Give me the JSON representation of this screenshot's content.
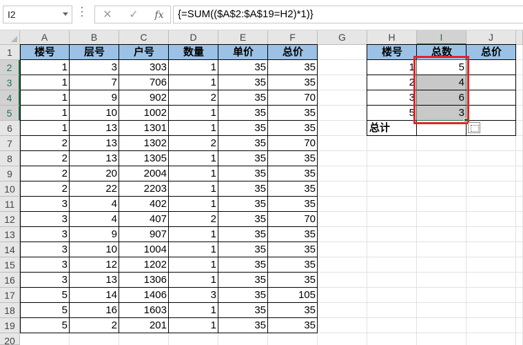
{
  "formula_bar": {
    "name_box": "I2",
    "cancel_glyph": "✕",
    "enter_glyph": "✓",
    "fx_label": "fx",
    "formula": "{=SUM(($A$2:$A$19=H2)*1)}"
  },
  "columns": [
    "A",
    "B",
    "C",
    "D",
    "E",
    "F",
    "G",
    "H",
    "I",
    "J"
  ],
  "rows": [
    "1",
    "2",
    "3",
    "4",
    "5",
    "6",
    "7",
    "8",
    "9",
    "10",
    "11",
    "12",
    "13",
    "14",
    "15",
    "16",
    "17",
    "18",
    "19",
    "20"
  ],
  "main_table": {
    "headers": [
      "楼号",
      "层号",
      "户号",
      "数量",
      "单价",
      "总价"
    ],
    "rows": [
      [
        "1",
        "3",
        "303",
        "1",
        "35",
        "35"
      ],
      [
        "1",
        "7",
        "706",
        "1",
        "35",
        "35"
      ],
      [
        "1",
        "9",
        "902",
        "2",
        "35",
        "70"
      ],
      [
        "1",
        "10",
        "1002",
        "1",
        "35",
        "35"
      ],
      [
        "1",
        "13",
        "1301",
        "1",
        "35",
        "35"
      ],
      [
        "2",
        "13",
        "1302",
        "2",
        "35",
        "70"
      ],
      [
        "2",
        "13",
        "1305",
        "1",
        "35",
        "35"
      ],
      [
        "2",
        "20",
        "2004",
        "1",
        "35",
        "35"
      ],
      [
        "2",
        "22",
        "2203",
        "1",
        "35",
        "35"
      ],
      [
        "3",
        "4",
        "402",
        "1",
        "35",
        "35"
      ],
      [
        "3",
        "4",
        "407",
        "2",
        "35",
        "70"
      ],
      [
        "3",
        "9",
        "907",
        "1",
        "35",
        "35"
      ],
      [
        "3",
        "10",
        "1004",
        "1",
        "35",
        "35"
      ],
      [
        "3",
        "12",
        "1202",
        "1",
        "35",
        "35"
      ],
      [
        "3",
        "13",
        "1306",
        "1",
        "35",
        "35"
      ],
      [
        "5",
        "14",
        "1406",
        "3",
        "35",
        "105"
      ],
      [
        "5",
        "16",
        "1603",
        "1",
        "35",
        "35"
      ],
      [
        "5",
        "2",
        "201",
        "1",
        "35",
        "35"
      ]
    ]
  },
  "summary_table": {
    "headers": [
      "楼号",
      "总数",
      "总价"
    ],
    "rows": [
      [
        "1",
        "5",
        ""
      ],
      [
        "2",
        "4",
        ""
      ],
      [
        "3",
        "6",
        ""
      ],
      [
        "5",
        "3",
        ""
      ]
    ],
    "total_label": "总计"
  },
  "colors": {
    "header_fill": "#9bc2e6",
    "selection_fill": "#c8c8c8",
    "highlight_box": "#e2232a",
    "excel_green": "#217346"
  },
  "icons": {
    "name_box_dropdown": "chevron-down-icon",
    "cancel": "close-icon",
    "enter": "check-icon",
    "function": "fx-icon",
    "quick_analysis": "quick-analysis-icon"
  }
}
